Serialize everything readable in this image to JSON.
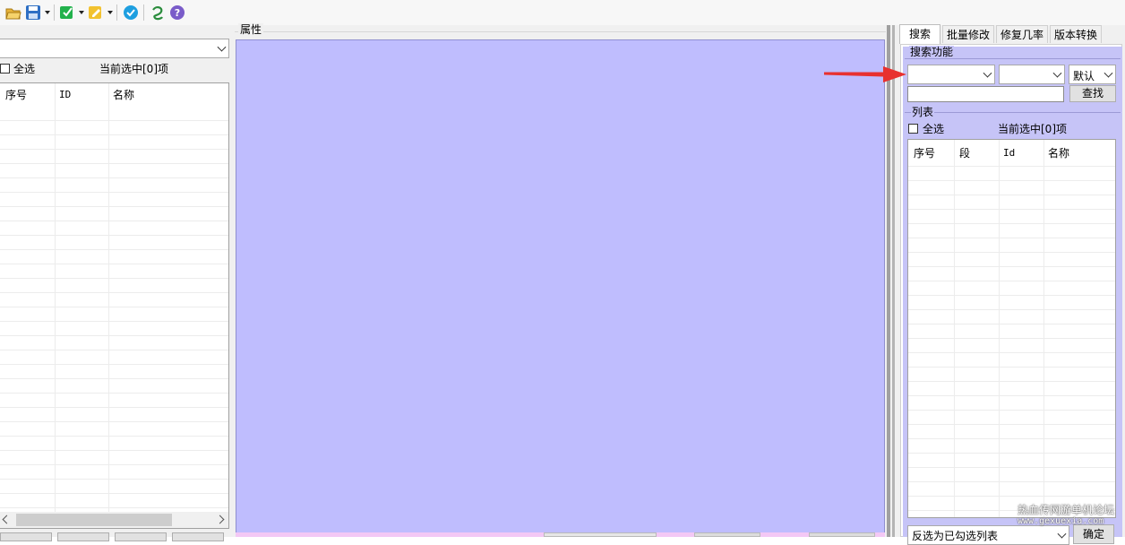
{
  "toolbar": {
    "icons": [
      "open-folder-icon",
      "save-icon",
      "edit-green-icon",
      "edit-yellow-icon",
      "check-circle-icon",
      "logo-icon",
      "help-icon"
    ]
  },
  "left": {
    "select_all": "全选",
    "selected_count": "当前选中[0]项",
    "columns": [
      "序号",
      "ID",
      "名称"
    ]
  },
  "middle": {
    "title": "属性"
  },
  "right": {
    "tabs": [
      "搜索",
      "批量修改",
      "修复几率",
      "版本转换"
    ],
    "search_group_title": "搜索功能",
    "mode_select_value": "默认",
    "find_button": "查找",
    "list_group_title": "列表",
    "select_all": "全选",
    "selected_count": "当前选中[0]项",
    "columns": [
      "序号",
      "段",
      "Id",
      "名称"
    ],
    "bottom_select_value": "反选为已勾选列表",
    "confirm_button": "确定"
  },
  "watermark": {
    "line1": "热血传网游单机论坛",
    "line2": "www.gexuexia.com"
  },
  "colors": {
    "property_area": "#bfbdfe",
    "search_group": "#c6c4f7",
    "bottom_strip": "#f3c8f5",
    "arrow": "#e8312f"
  }
}
